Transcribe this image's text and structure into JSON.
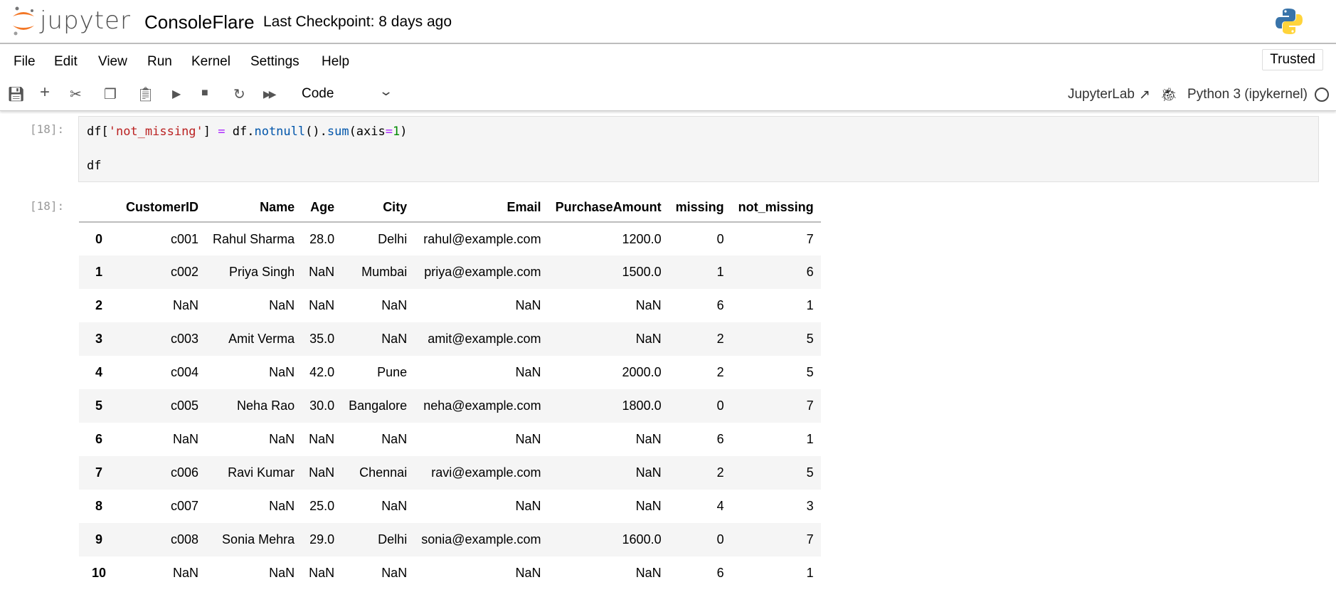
{
  "header": {
    "logo_text": "jupyter",
    "notebook_title": "ConsoleFlare",
    "checkpoint": "Last Checkpoint: 8 days ago"
  },
  "menu": [
    "File",
    "Edit",
    "View",
    "Run",
    "Kernel",
    "Settings",
    "Help"
  ],
  "trusted": "Trusted",
  "toolbar": {
    "cell_type": "Code",
    "jupyterlab": "JupyterLab",
    "kernel": "Python 3 (ipykernel)"
  },
  "cell": {
    "in_prompt": "[18]:",
    "out_prompt": "[18]:",
    "code_line1": {
      "a": "df[",
      "b": "'not_missing'",
      "c": "] ",
      "d": "=",
      "e": " df.",
      "f": "notnull",
      "g": "().",
      "h": "sum",
      "i": "(axis",
      "j": "=",
      "k": "1",
      "l": ")"
    },
    "code_line2": "df"
  },
  "table": {
    "columns": [
      "",
      "CustomerID",
      "Name",
      "Age",
      "City",
      "Email",
      "PurchaseAmount",
      "missing",
      "not_missing"
    ],
    "rows": [
      [
        "0",
        "c001",
        "Rahul Sharma",
        "28.0",
        "Delhi",
        "rahul@example.com",
        "1200.0",
        "0",
        "7"
      ],
      [
        "1",
        "c002",
        "Priya Singh",
        "NaN",
        "Mumbai",
        "priya@example.com",
        "1500.0",
        "1",
        "6"
      ],
      [
        "2",
        "NaN",
        "NaN",
        "NaN",
        "NaN",
        "NaN",
        "NaN",
        "6",
        "1"
      ],
      [
        "3",
        "c003",
        "Amit Verma",
        "35.0",
        "NaN",
        "amit@example.com",
        "NaN",
        "2",
        "5"
      ],
      [
        "4",
        "c004",
        "NaN",
        "42.0",
        "Pune",
        "NaN",
        "2000.0",
        "2",
        "5"
      ],
      [
        "5",
        "c005",
        "Neha Rao",
        "30.0",
        "Bangalore",
        "neha@example.com",
        "1800.0",
        "0",
        "7"
      ],
      [
        "6",
        "NaN",
        "NaN",
        "NaN",
        "NaN",
        "NaN",
        "NaN",
        "6",
        "1"
      ],
      [
        "7",
        "c006",
        "Ravi Kumar",
        "NaN",
        "Chennai",
        "ravi@example.com",
        "NaN",
        "2",
        "5"
      ],
      [
        "8",
        "c007",
        "NaN",
        "25.0",
        "NaN",
        "NaN",
        "NaN",
        "4",
        "3"
      ],
      [
        "9",
        "c008",
        "Sonia Mehra",
        "29.0",
        "Delhi",
        "sonia@example.com",
        "1600.0",
        "0",
        "7"
      ],
      [
        "10",
        "NaN",
        "NaN",
        "NaN",
        "NaN",
        "NaN",
        "NaN",
        "6",
        "1"
      ]
    ]
  }
}
